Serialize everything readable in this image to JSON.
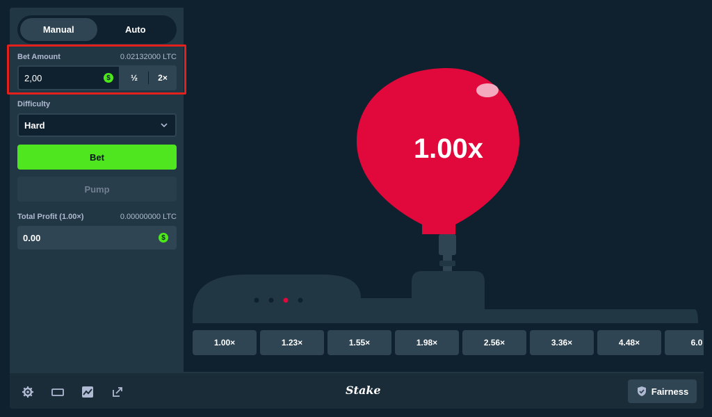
{
  "mode_toggle": {
    "manual": "Manual",
    "auto": "Auto",
    "active": "Manual"
  },
  "bet_amount": {
    "label": "Bet Amount",
    "crypto_value": "0.02132000 LTC",
    "value": "2,00",
    "half": "½",
    "double": "2×",
    "currency_icon": "dollar-coin-icon"
  },
  "difficulty": {
    "label": "Difficulty",
    "selected": "Hard"
  },
  "buttons": {
    "bet": "Bet",
    "pump": "Pump"
  },
  "total_profit": {
    "label": "Total Profit (1.00×)",
    "crypto_value": "0.00000000 LTC",
    "value": "0.00"
  },
  "game": {
    "balloon_multiplier": "1.00x",
    "multipliers": [
      "1.00×",
      "1.23×",
      "1.55×",
      "1.98×",
      "2.56×",
      "3.36×",
      "4.48×",
      "6.0"
    ],
    "pump_dots_active_index": 2
  },
  "footer": {
    "logo": "Stake",
    "fairness": "Fairness",
    "icons": [
      "gear-icon",
      "theater-mode-icon",
      "stats-icon",
      "popout-icon"
    ]
  },
  "colors": {
    "accent_green": "#4fe61f",
    "balloon_red": "#e1083b",
    "bg_dark": "#0f212e",
    "panel": "#213743",
    "highlight": "#e3201b"
  }
}
